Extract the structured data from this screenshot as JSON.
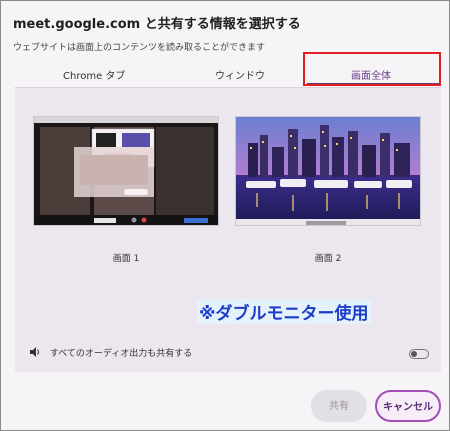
{
  "dialog": {
    "title": "meet.google.com と共有する情報を選択する",
    "subtitle": "ウェブサイトは画面上のコンテンツを読み取ることができます"
  },
  "tabs": [
    {
      "label": "Chrome タブ",
      "active": false
    },
    {
      "label": "ウィンドウ",
      "active": false
    },
    {
      "label": "画面全体",
      "active": true
    }
  ],
  "screens": [
    {
      "label": "画面 1"
    },
    {
      "label": "画面 2"
    }
  ],
  "annotation": "※ダブルモニター使用",
  "audio": {
    "label": "すべてのオーディオ出力も共有する",
    "enabled": false
  },
  "buttons": {
    "share": "共有",
    "cancel": "キャンセル"
  },
  "colors": {
    "accent": "#6a3d86",
    "highlight": "#e02020",
    "annotation": "#1b3cc8"
  }
}
